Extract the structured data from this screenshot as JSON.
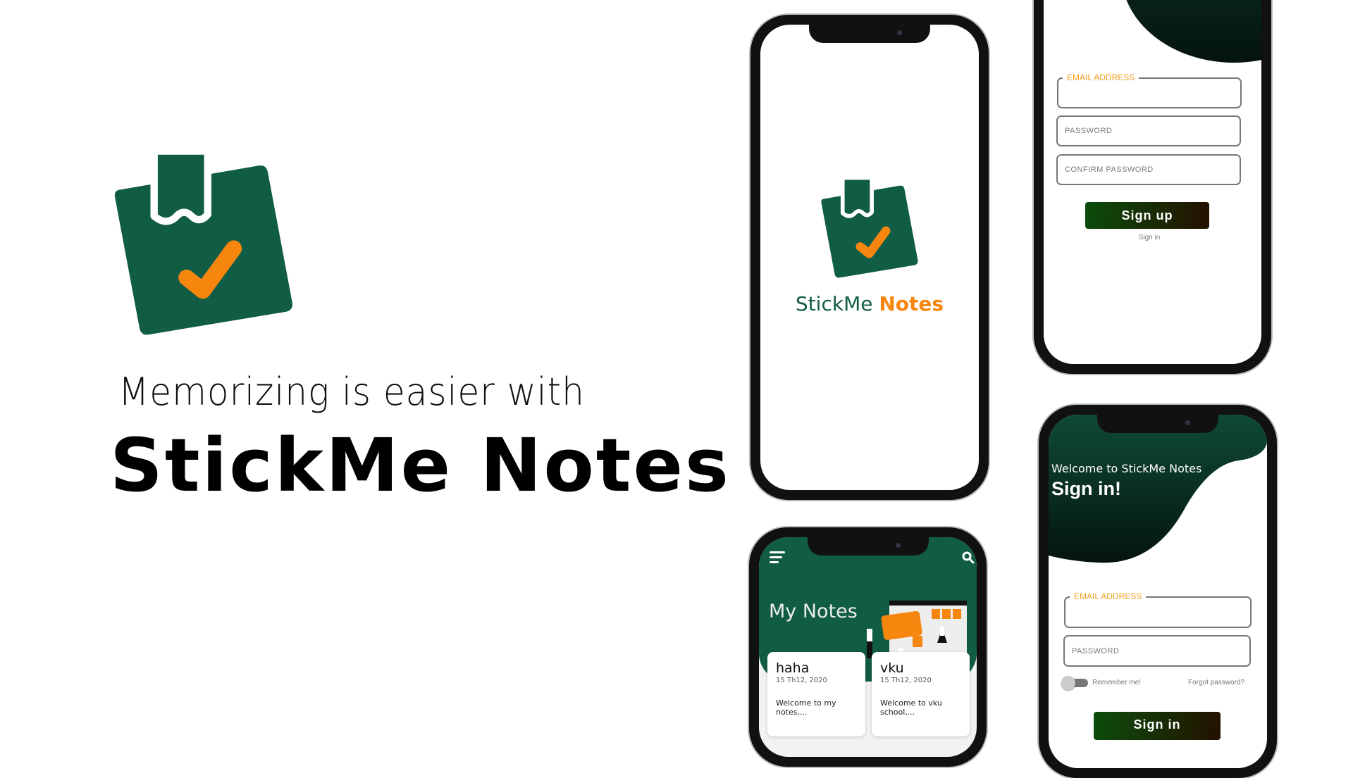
{
  "colors": {
    "brand_green": "#115c45",
    "accent_orange": "#f7860f",
    "field_label": "#f0a020"
  },
  "hero": {
    "tagline": "Memorizing is easier with",
    "brand": "StickMe Notes"
  },
  "splash": {
    "name_part1": "StickMe",
    "name_part2": "Notes"
  },
  "signup": {
    "email_label": "EMAIL ADDRESS",
    "password_placeholder": "PASSWORD",
    "confirm_placeholder": "CONFIRM PASSWORD",
    "button": "Sign up",
    "signin_link": "Sign in"
  },
  "notes": {
    "title": "My Notes",
    "menu_icon": "hamburger-icon",
    "search_icon": "search-icon",
    "cards": [
      {
        "title": "haha",
        "date": "15 Th12, 2020",
        "preview": "Welcome to my notes,..."
      },
      {
        "title": "vku",
        "date": "15 Th12, 2020",
        "preview": "Welcome to vku school,..."
      }
    ]
  },
  "signin": {
    "welcome": "Welcome to StickMe Notes",
    "heading": "Sign in!",
    "email_label": "EMAIL ADDRESS",
    "password_placeholder": "PASSWORD",
    "remember": "Remember me!",
    "forgot": "Forgot password?",
    "button": "Sign in",
    "remember_on": false
  }
}
